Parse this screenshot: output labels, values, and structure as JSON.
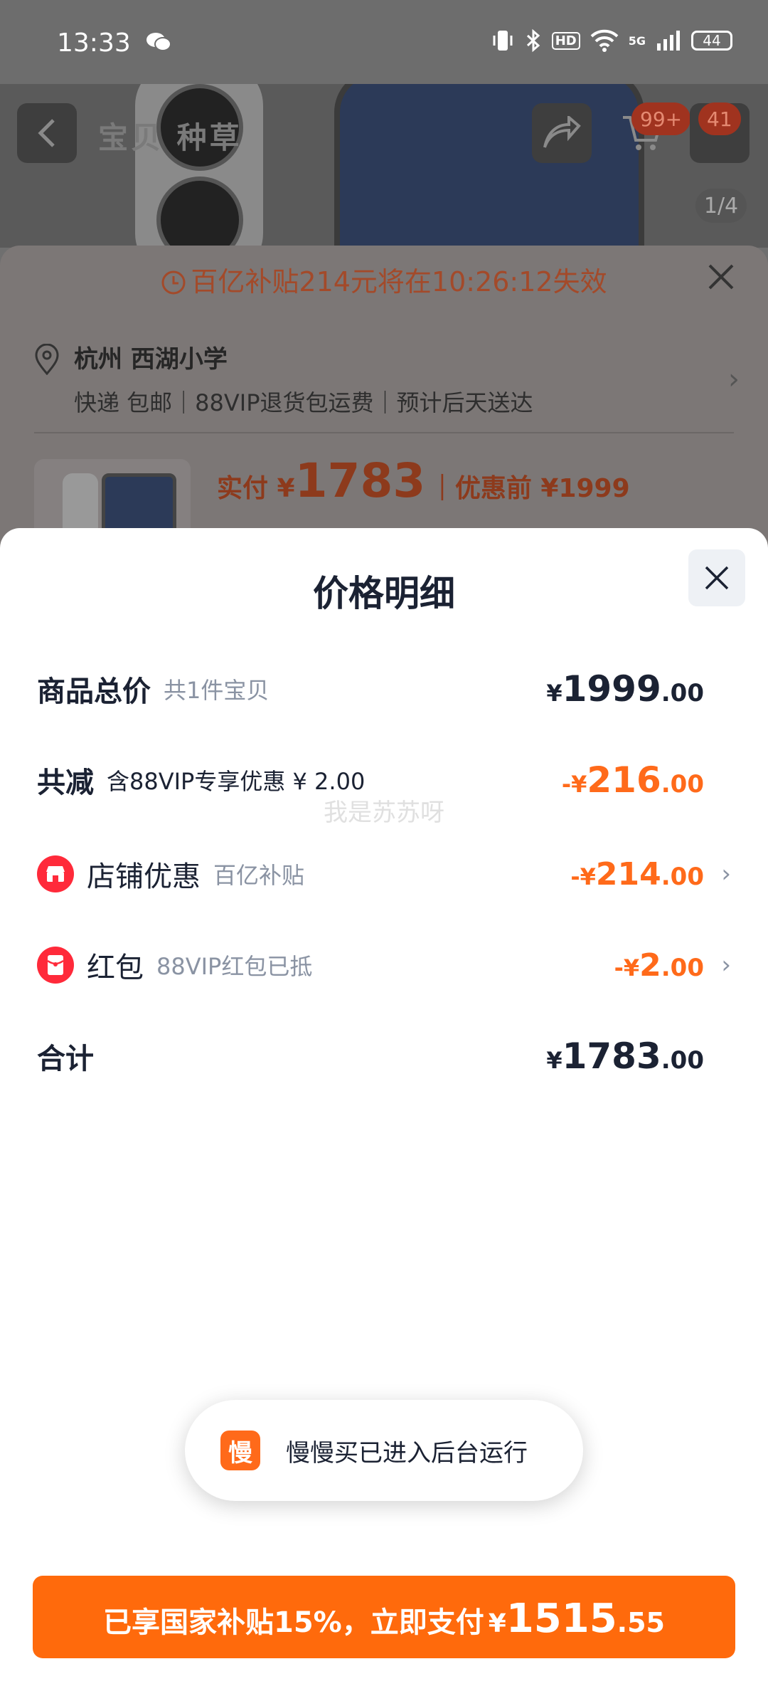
{
  "status_bar": {
    "time": "13:33",
    "network": "5G",
    "hd": "HD",
    "battery": "44"
  },
  "background_page": {
    "nav_tabs": "宝贝 种草",
    "cart_badge": "99+",
    "message_badge": "41",
    "image_pager": "1/4",
    "subsidy_banner": "百亿补贴214元将在10:26:12失效",
    "address_title": "杭州 西湖小学",
    "delivery_info": "快递 包邮｜88VIP退货包运费｜预计后天送达",
    "pay_label": "实付 ¥",
    "pay_amount": "1783",
    "before_discount": "｜优惠前 ¥1999"
  },
  "sheet": {
    "title": "价格明细",
    "watermark": "我是苏苏呀",
    "rows": [
      {
        "label": "商品总价",
        "sub": "共1件宝贝",
        "prefix": "",
        "yen": "¥",
        "int": "1999",
        "dec": ".00",
        "color": "#1b2233",
        "chevron": false
      },
      {
        "label": "共减",
        "sub": "含88VIP专享优惠 ¥ 2.00",
        "prefix": "-",
        "yen": "¥",
        "int": "216",
        "dec": ".00",
        "color": "#ff6a1a",
        "chevron": false
      },
      {
        "label": "店铺优惠",
        "sub": "百亿补贴",
        "prefix": "-",
        "yen": "¥",
        "int": "214",
        "dec": ".00",
        "color": "#ff6a1a",
        "icon": "store-icon",
        "chevron": true
      },
      {
        "label": "红包",
        "sub": "88VIP红包已抵",
        "prefix": "-",
        "yen": "¥",
        "int": "2",
        "dec": ".00",
        "color": "#ff6a1a",
        "icon": "red-packet-icon",
        "chevron": true
      },
      {
        "label": "合计",
        "yen": "¥",
        "int": "1783",
        "dec": ".00",
        "color": "#1b2233",
        "chevron": false
      }
    ]
  },
  "toast": {
    "app_icon_text": "慢",
    "message": "慢慢买已进入后台运行"
  },
  "pay_button": {
    "text": "已享国家补贴15%，立即支付",
    "yen": "¥",
    "int": "1515",
    "dec": ".55",
    "color": "#ff6a0c"
  }
}
